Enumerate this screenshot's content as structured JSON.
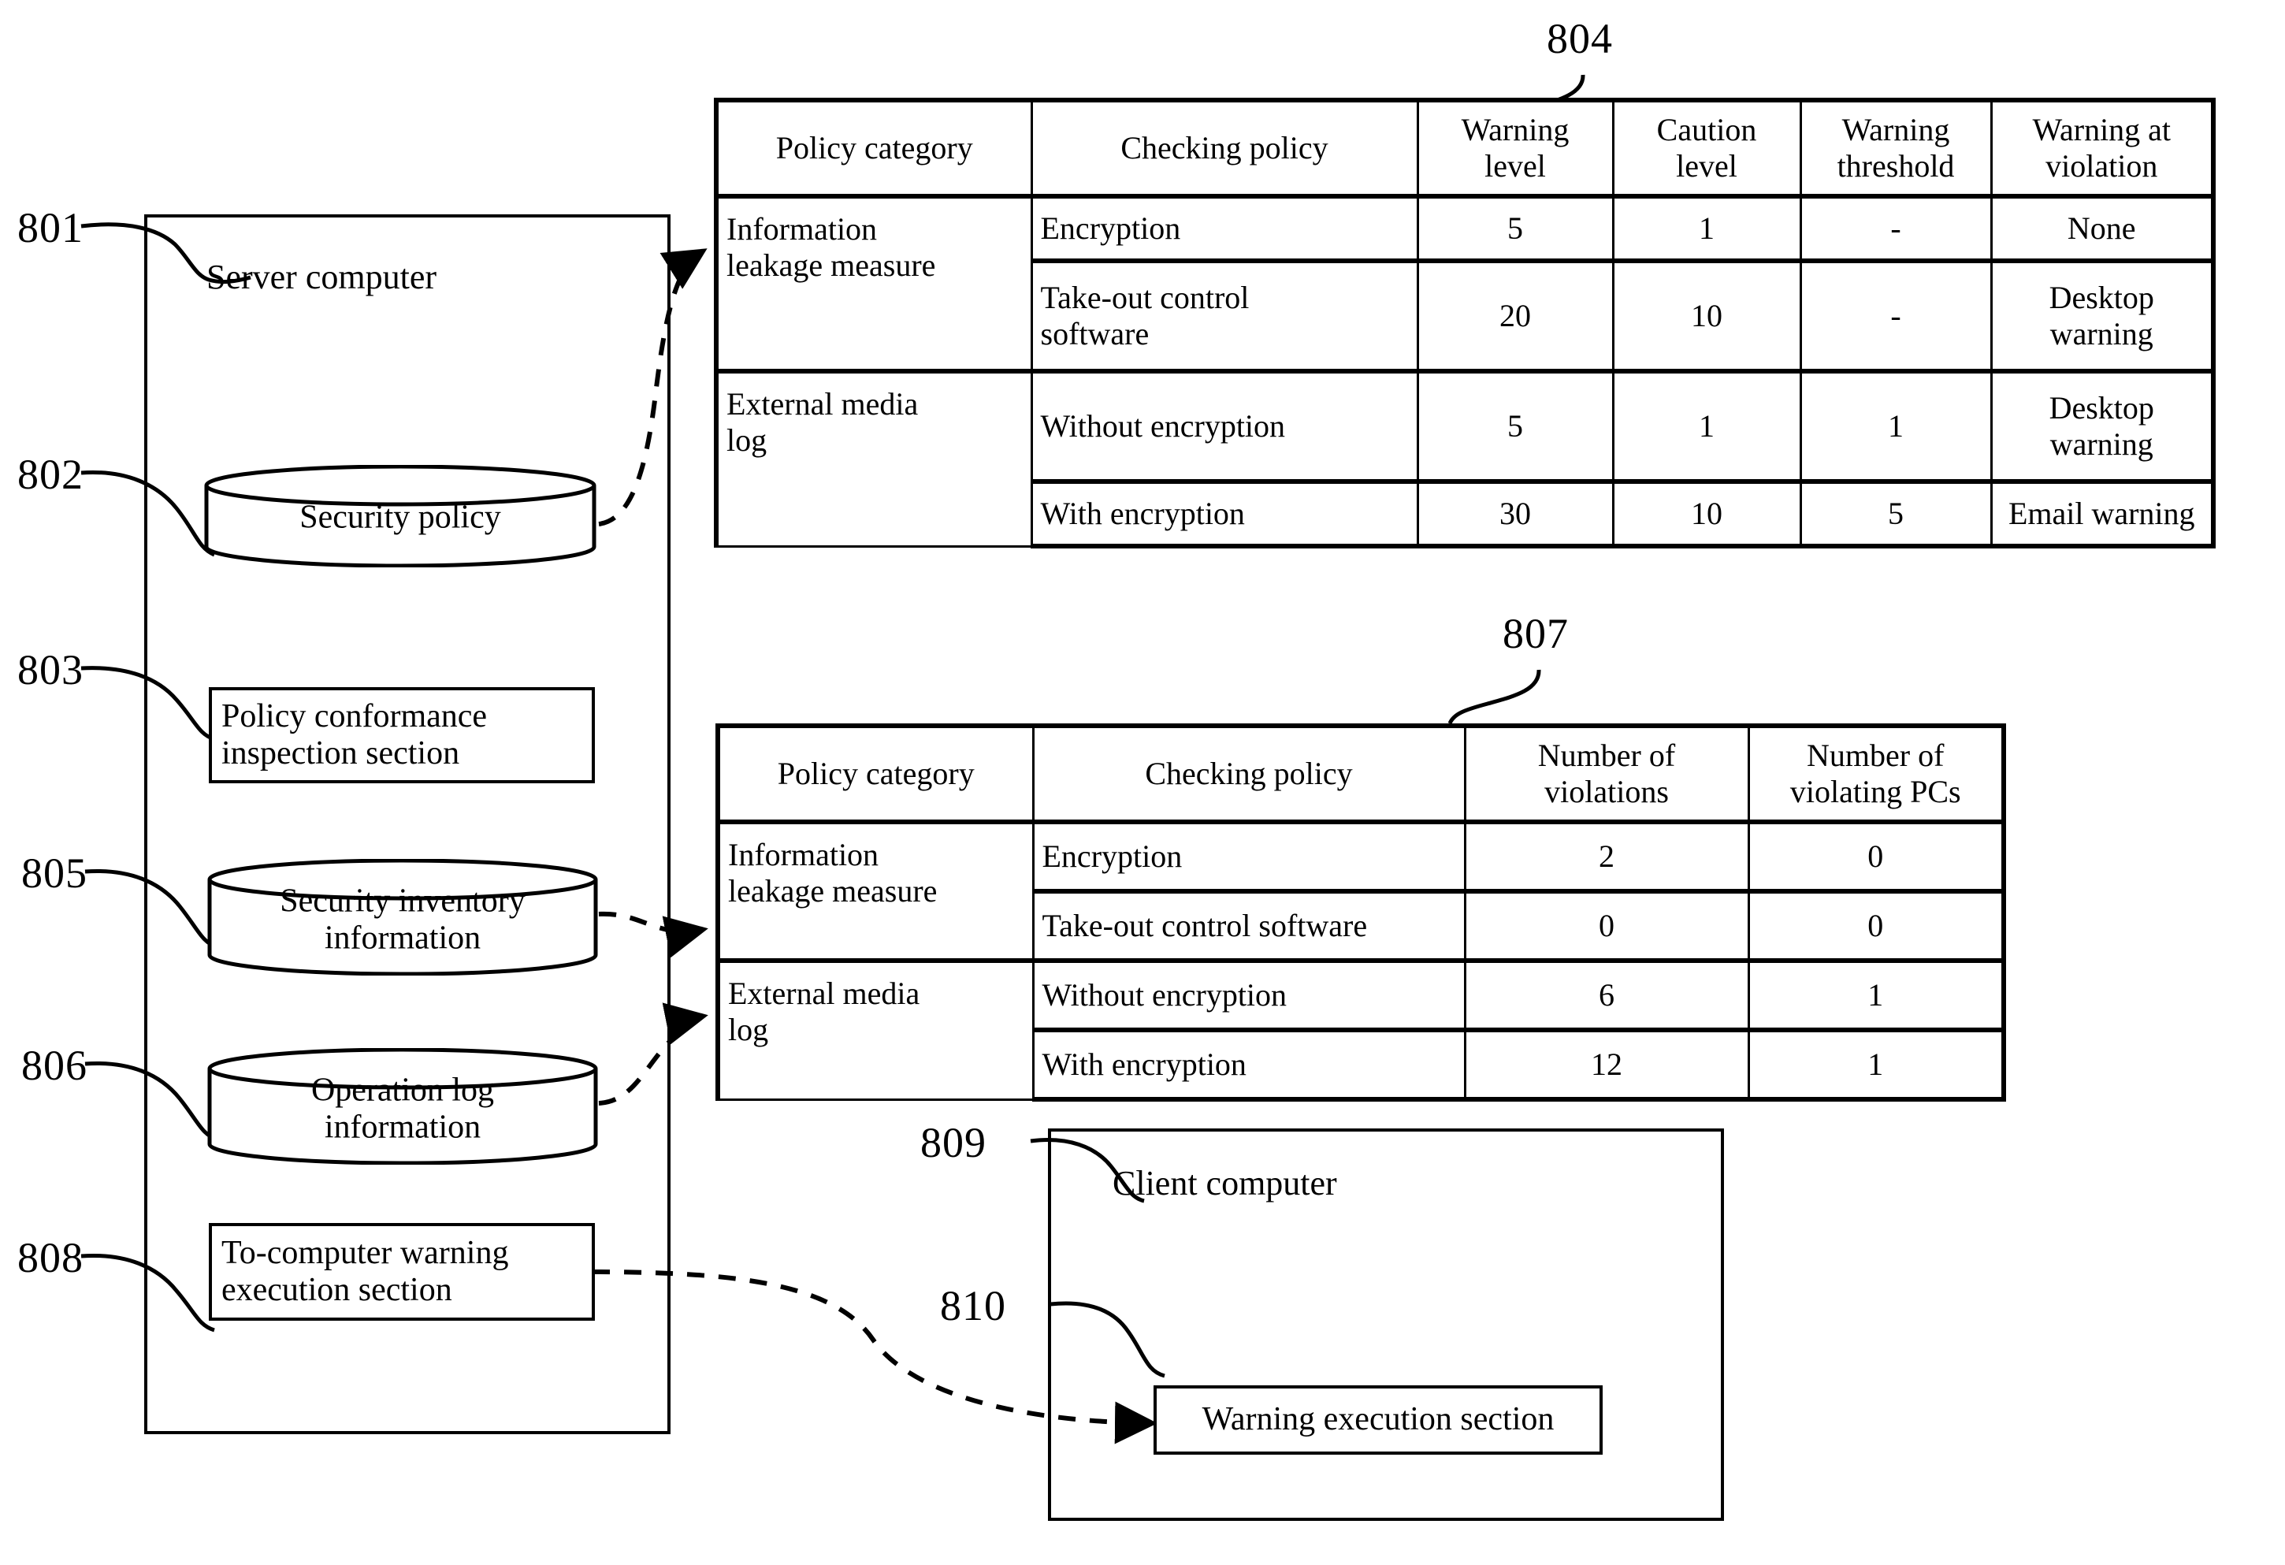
{
  "figure": {
    "refs": {
      "server_computer": "801",
      "security_policy": "802",
      "policy_conformance_inspection_section": "803",
      "security_policy_table": "804",
      "security_inventory_information": "805",
      "operation_log_information": "806",
      "violation_summary_table": "807",
      "to_computer_warning_execution_section": "808",
      "client_computer": "809",
      "warning_execution_section": "810"
    }
  },
  "server": {
    "title": "Server computer",
    "security_policy_db": "Security policy",
    "policy_conformance_module": "Policy conformance\ninspection section",
    "security_inventory_db": "Security inventory\ninformation",
    "operation_log_db": "Operation log\ninformation",
    "warning_exec_module": "To-computer warning\nexecution section"
  },
  "client": {
    "title": "Client computer",
    "warning_execution_module": "Warning execution section"
  },
  "table_804": {
    "headers": [
      "Policy category",
      "Checking policy",
      "Warning\nlevel",
      "Caution\nlevel",
      "Warning\nthreshold",
      "Warning at\nviolation"
    ],
    "categories": [
      {
        "name": "Information\nleakage measure",
        "rows": [
          {
            "policy": "Encryption",
            "warning_level": "5",
            "caution_level": "1",
            "warning_threshold": "-",
            "warning_at_violation": "None"
          },
          {
            "policy": "Take-out control\nsoftware",
            "warning_level": "20",
            "caution_level": "10",
            "warning_threshold": "-",
            "warning_at_violation": "Desktop\nwarning"
          }
        ]
      },
      {
        "name": "External media\nlog",
        "rows": [
          {
            "policy": "Without encryption",
            "warning_level": "5",
            "caution_level": "1",
            "warning_threshold": "1",
            "warning_at_violation": "Desktop\nwarning"
          },
          {
            "policy": "With encryption",
            "warning_level": "30",
            "caution_level": "10",
            "warning_threshold": "5",
            "warning_at_violation": "Email warning"
          }
        ]
      }
    ]
  },
  "table_807": {
    "headers": [
      "Policy category",
      "Checking policy",
      "Number of\nviolations",
      "Number of\nviolating PCs"
    ],
    "categories": [
      {
        "name": "Information\nleakage measure",
        "rows": [
          {
            "policy": "Encryption",
            "violations": "2",
            "violating_pcs": "0"
          },
          {
            "policy": "Take-out control software",
            "violations": "0",
            "violating_pcs": "0"
          }
        ]
      },
      {
        "name": "External media\nlog",
        "rows": [
          {
            "policy": "Without encryption",
            "violations": "6",
            "violating_pcs": "1"
          },
          {
            "policy": "With encryption",
            "violations": "12",
            "violating_pcs": "1"
          }
        ]
      }
    ]
  },
  "colors": {
    "line": "#000000",
    "background": "#ffffff"
  }
}
